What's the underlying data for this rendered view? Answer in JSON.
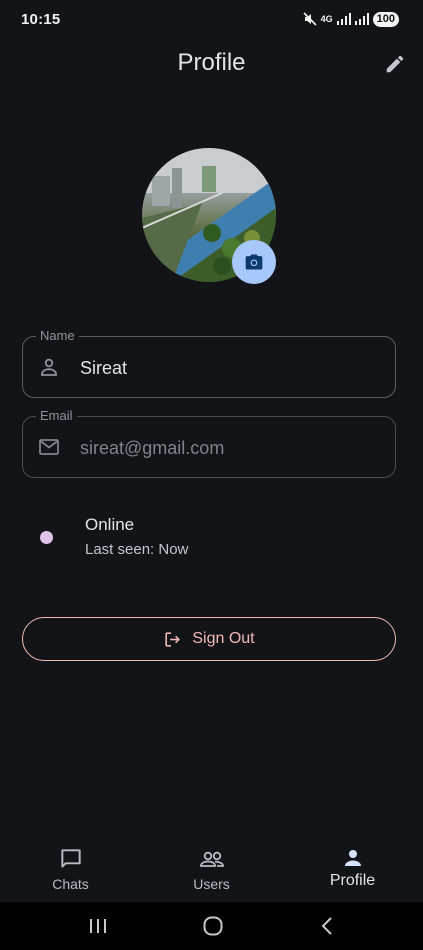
{
  "status_bar": {
    "time": "10:15",
    "network": "4G",
    "battery": "100"
  },
  "header": {
    "title": "Profile"
  },
  "form": {
    "name": {
      "label": "Name",
      "value": "Sireat"
    },
    "email": {
      "label": "Email",
      "value": "sireat@gmail.com"
    }
  },
  "presence": {
    "status": "Online",
    "last_seen": "Last seen: Now"
  },
  "actions": {
    "sign_out": "Sign Out"
  },
  "bottom_nav": {
    "items": [
      {
        "label": "Chats",
        "icon": "chat-bubble-icon"
      },
      {
        "label": "Users",
        "icon": "users-icon"
      },
      {
        "label": "Profile",
        "icon": "person-icon",
        "active": true
      }
    ]
  },
  "colors": {
    "background": "#121418",
    "accent": "#a8c7fa",
    "sign_out": "#f2b8b5",
    "online_dot": "#e1c3e8"
  }
}
